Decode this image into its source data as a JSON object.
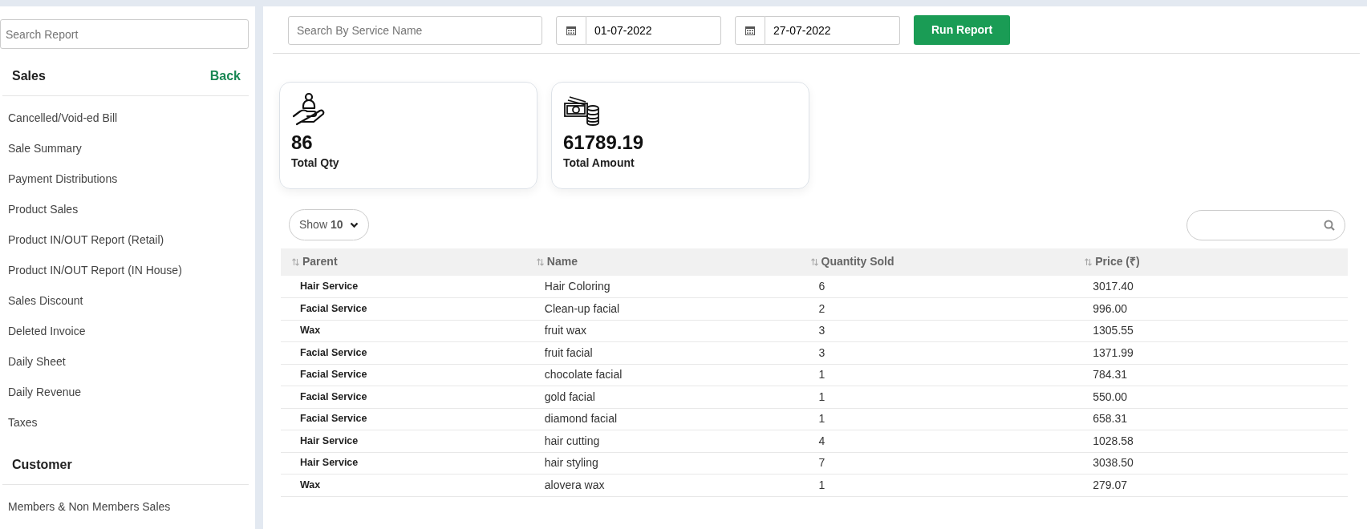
{
  "sidebar": {
    "search": {
      "placeholder": "Search Report"
    },
    "sections": [
      {
        "title": "Sales",
        "back": "Back",
        "items": [
          "Cancelled/Void-ed Bill",
          "Sale Summary",
          "Payment Distributions",
          "Product Sales",
          "Product IN/OUT Report (Retail)",
          "Product IN/OUT Report (IN House)",
          "Sales Discount",
          "Deleted Invoice",
          "Daily Sheet",
          "Daily Revenue",
          "Taxes"
        ]
      },
      {
        "title": "Customer",
        "items": [
          "Members & Non Members Sales"
        ]
      }
    ]
  },
  "filters": {
    "service_search": {
      "placeholder": "Search By Service Name"
    },
    "from_date": "01-07-2022",
    "to_date": "27-07-2022",
    "run_button": "Run Report"
  },
  "stats": [
    {
      "kind": "qty",
      "value": "86",
      "label": "Total Qty"
    },
    {
      "kind": "amount",
      "value": "61789.19",
      "label": "Total Amount"
    }
  ],
  "table": {
    "show_entries": "Show **10**",
    "columns": [
      "Parent",
      "Name",
      "Quantity Sold",
      "Price (₹)"
    ],
    "rows": [
      [
        "Hair Service",
        "Hair Coloring",
        "6",
        "3017.40"
      ],
      [
        "Facial Service",
        "Clean-up facial",
        "2",
        "996.00"
      ],
      [
        "Wax",
        "fruit wax",
        "3",
        "1305.55"
      ],
      [
        "Facial Service",
        "fruit facial",
        "3",
        "1371.99"
      ],
      [
        "Facial Service",
        "chocolate facial",
        "1",
        "784.31"
      ],
      [
        "Facial Service",
        "gold facial",
        "1",
        "550.00"
      ],
      [
        "Facial Service",
        "diamond facial",
        "1",
        "658.31"
      ],
      [
        "Hair Service",
        "hair cutting",
        "4",
        "1028.58"
      ],
      [
        "Hair Service",
        "hair styling",
        "7",
        "3038.50"
      ],
      [
        "Wax",
        "alovera wax",
        "1",
        "279.07"
      ]
    ]
  }
}
